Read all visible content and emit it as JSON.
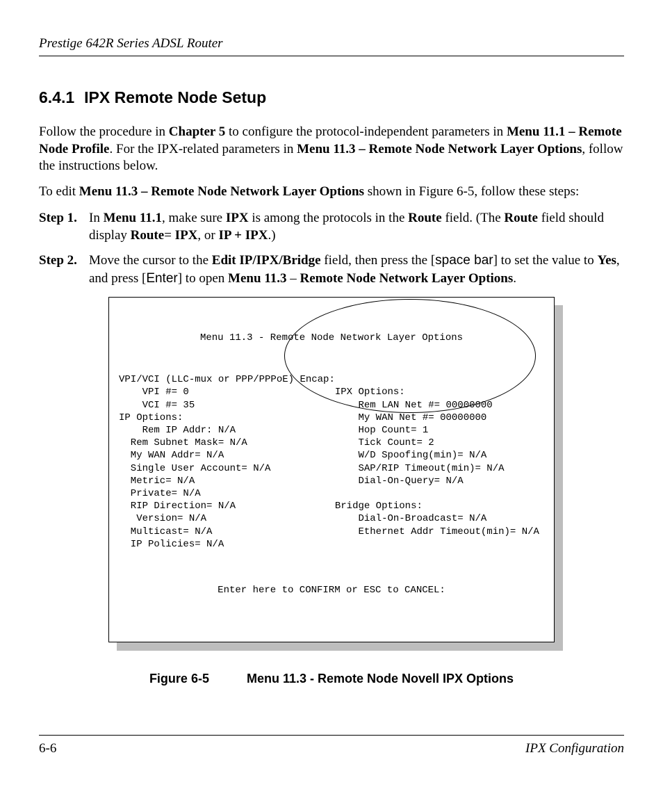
{
  "header": {
    "running_title": "Prestige 642R Series ADSL Router"
  },
  "section": {
    "number": "6.4.1",
    "title": "IPX Remote Node Setup"
  },
  "para1": {
    "p1a": "Follow the procedure in ",
    "p1b": "Chapter 5",
    "p1c": " to configure the protocol-independent parameters in ",
    "p1d": "Menu 11.1 – Remote Node Profile",
    "p1e": ".  For the IPX-related parameters in ",
    "p1f": "Menu 11.3 – Remote Node Network Layer Options",
    "p1g": ", follow the instructions below."
  },
  "para2": {
    "p2a": "To edit ",
    "p2b": "Menu 11.3 – Remote Node Network Layer Options",
    "p2c": " shown in Figure 6-5, follow these steps:"
  },
  "steps": {
    "s1": {
      "label": "Step 1.",
      "a": "In ",
      "b": "Menu 11.1",
      "c": ", make sure ",
      "d": "IPX",
      "e": " is among the protocols in the ",
      "f": "Route",
      "g": " field. (The ",
      "h": "Route",
      "i": " field should display ",
      "j": "Route",
      "k": "= ",
      "l": "IPX",
      "m": ", or ",
      "n": "IP + IPX",
      "o": ".)"
    },
    "s2": {
      "label": "Step 2.",
      "a": "Move the cursor to the ",
      "b": "Edit IP/IPX/Bridge",
      "c": " field, then press the [",
      "d": "space bar",
      "e": "] to set the value to ",
      "f": "Yes",
      "g": ", and press [",
      "h": "Enter",
      "i": "] to open ",
      "j": "Menu 11.3",
      "k": " – ",
      "l": "Remote Node Network Layer Options",
      "m": "."
    }
  },
  "menu": {
    "title": "Menu 11.3 - Remote Node Network Layer Options",
    "left": "VPI/VCI (LLC-mux or PPP/PPPoE) Encap:\n    VPI #= 0\n    VCI #= 35\nIP Options:\n    Rem IP Addr: N/A\n  Rem Subnet Mask= N/A\n  My WAN Addr= N/A\n  Single User Account= N/A\n  Metric= N/A\n  Private= N/A\n  RIP Direction= N/A\n   Version= N/A\n  Multicast= N/A\n  IP Policies= N/A",
    "right": "\nIPX Options:\n    Rem LAN Net #= 00000000\n    My WAN Net #= 00000000\n    Hop Count= 1\n    Tick Count= 2\n    W/D Spoofing(min)= N/A\n    SAP/RIP Timeout(min)= N/A\n    Dial-On-Query= N/A\n\nBridge Options:\n    Dial-On-Broadcast= N/A\n    Ethernet Addr Timeout(min)= N/A",
    "footer": "Enter here to CONFIRM or ESC to CANCEL:"
  },
  "figure": {
    "number": "Figure 6-5",
    "caption": "Menu 11.3 - Remote Node Novell IPX Options"
  },
  "footer": {
    "page_number": "6-6",
    "section": "IPX Configuration"
  }
}
